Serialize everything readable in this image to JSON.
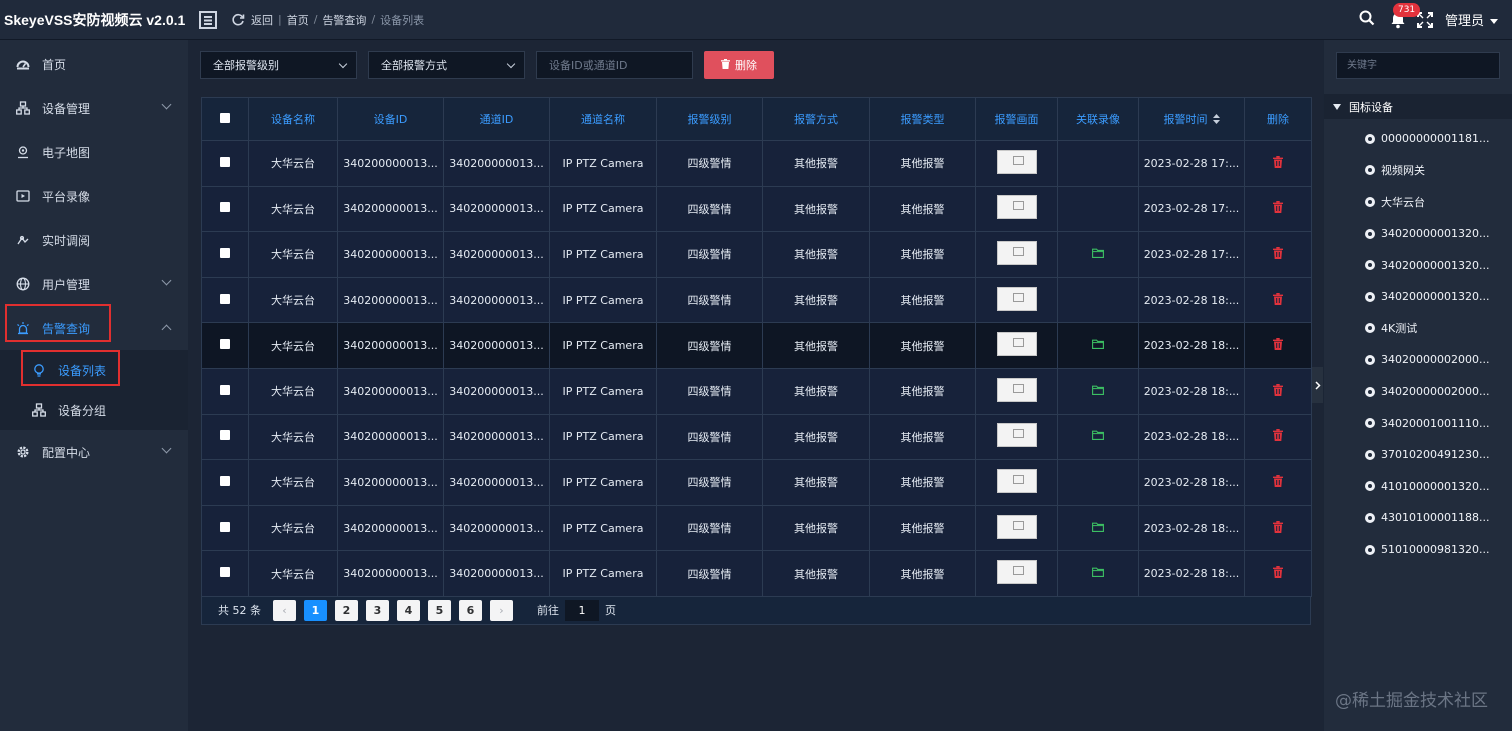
{
  "header": {
    "brand": "SkeyeVSS安防视频云 v2.0.1",
    "breadcrumbs": [
      "返回",
      "首页",
      "告警查询",
      "设备列表"
    ],
    "notification_count": "731",
    "user": "管理员"
  },
  "sidebar": {
    "items": [
      {
        "label": "首页",
        "icon": "dashboard-icon"
      },
      {
        "label": "设备管理",
        "icon": "device-tree-icon"
      },
      {
        "label": "电子地图",
        "icon": "map-icon"
      },
      {
        "label": "平台录像",
        "icon": "video-icon"
      },
      {
        "label": "实时调阅",
        "icon": "live-icon"
      },
      {
        "label": "用户管理",
        "icon": "globe-icon"
      },
      {
        "label": "告警查询",
        "icon": "alarm-icon"
      },
      {
        "label": "配置中心",
        "icon": "gear-icon"
      }
    ],
    "sub_items": [
      {
        "label": "设备列表",
        "icon": "bulb-icon"
      },
      {
        "label": "设备分组",
        "icon": "group-icon"
      }
    ]
  },
  "toolbar": {
    "level_select": "全部报警级别",
    "method_select": "全部报警方式",
    "search_placeholder": "设备ID或通道ID",
    "delete_label": "删除"
  },
  "table": {
    "columns": [
      "设备名称",
      "设备ID",
      "通道ID",
      "通道名称",
      "报警级别",
      "报警方式",
      "报警类型",
      "报警画面",
      "关联录像",
      "报警时间",
      "删除"
    ],
    "rows": [
      {
        "name": "大华云台",
        "device_id": "340200000013...",
        "channel_id": "340200000013...",
        "channel_name": "IP PTZ Camera",
        "level": "四级警情",
        "method": "其他报警",
        "type": "其他报警",
        "video": false,
        "time": "2023-02-28 17:..."
      },
      {
        "name": "大华云台",
        "device_id": "340200000013...",
        "channel_id": "340200000013...",
        "channel_name": "IP PTZ Camera",
        "level": "四级警情",
        "method": "其他报警",
        "type": "其他报警",
        "video": false,
        "time": "2023-02-28 17:..."
      },
      {
        "name": "大华云台",
        "device_id": "340200000013...",
        "channel_id": "340200000013...",
        "channel_name": "IP PTZ Camera",
        "level": "四级警情",
        "method": "其他报警",
        "type": "其他报警",
        "video": true,
        "time": "2023-02-28 17:..."
      },
      {
        "name": "大华云台",
        "device_id": "340200000013...",
        "channel_id": "340200000013...",
        "channel_name": "IP PTZ Camera",
        "level": "四级警情",
        "method": "其他报警",
        "type": "其他报警",
        "video": false,
        "time": "2023-02-28 18:..."
      },
      {
        "name": "大华云台",
        "device_id": "340200000013...",
        "channel_id": "340200000013...",
        "channel_name": "IP PTZ Camera",
        "level": "四级警情",
        "method": "其他报警",
        "type": "其他报警",
        "video": true,
        "time": "2023-02-28 18:..."
      },
      {
        "name": "大华云台",
        "device_id": "340200000013...",
        "channel_id": "340200000013...",
        "channel_name": "IP PTZ Camera",
        "level": "四级警情",
        "method": "其他报警",
        "type": "其他报警",
        "video": true,
        "time": "2023-02-28 18:..."
      },
      {
        "name": "大华云台",
        "device_id": "340200000013...",
        "channel_id": "340200000013...",
        "channel_name": "IP PTZ Camera",
        "level": "四级警情",
        "method": "其他报警",
        "type": "其他报警",
        "video": true,
        "time": "2023-02-28 18:..."
      },
      {
        "name": "大华云台",
        "device_id": "340200000013...",
        "channel_id": "340200000013...",
        "channel_name": "IP PTZ Camera",
        "level": "四级警情",
        "method": "其他报警",
        "type": "其他报警",
        "video": false,
        "time": "2023-02-28 18:..."
      },
      {
        "name": "大华云台",
        "device_id": "340200000013...",
        "channel_id": "340200000013...",
        "channel_name": "IP PTZ Camera",
        "level": "四级警情",
        "method": "其他报警",
        "type": "其他报警",
        "video": true,
        "time": "2023-02-28 18:..."
      },
      {
        "name": "大华云台",
        "device_id": "340200000013...",
        "channel_id": "340200000013...",
        "channel_name": "IP PTZ Camera",
        "level": "四级警情",
        "method": "其他报警",
        "type": "其他报警",
        "video": true,
        "time": "2023-02-28 18:..."
      }
    ]
  },
  "pagination": {
    "total": "共 52 条",
    "pages": [
      "1",
      "2",
      "3",
      "4",
      "5",
      "6"
    ],
    "current": "1",
    "goto_label": "前往",
    "goto_value": "1",
    "page_suffix": "页"
  },
  "right_panel": {
    "keyword_placeholder": "关键字",
    "root": "国标设备",
    "nodes": [
      "00000000001181...",
      "视频网关",
      "大华云台",
      "34020000001320...",
      "34020000001320...",
      "34020000001320...",
      "4K测试",
      "34020000002000...",
      "34020000002000...",
      "34020001001110...",
      "37010200491230...",
      "41010000001320...",
      "43010100001188...",
      "51010000981320..."
    ]
  },
  "watermark": "@稀土掘金技术社区",
  "colors": {
    "accent": "#3b9cff",
    "danger": "#e0505d",
    "highlight_border": "#e02f2f",
    "video_green": "#3cc063"
  }
}
